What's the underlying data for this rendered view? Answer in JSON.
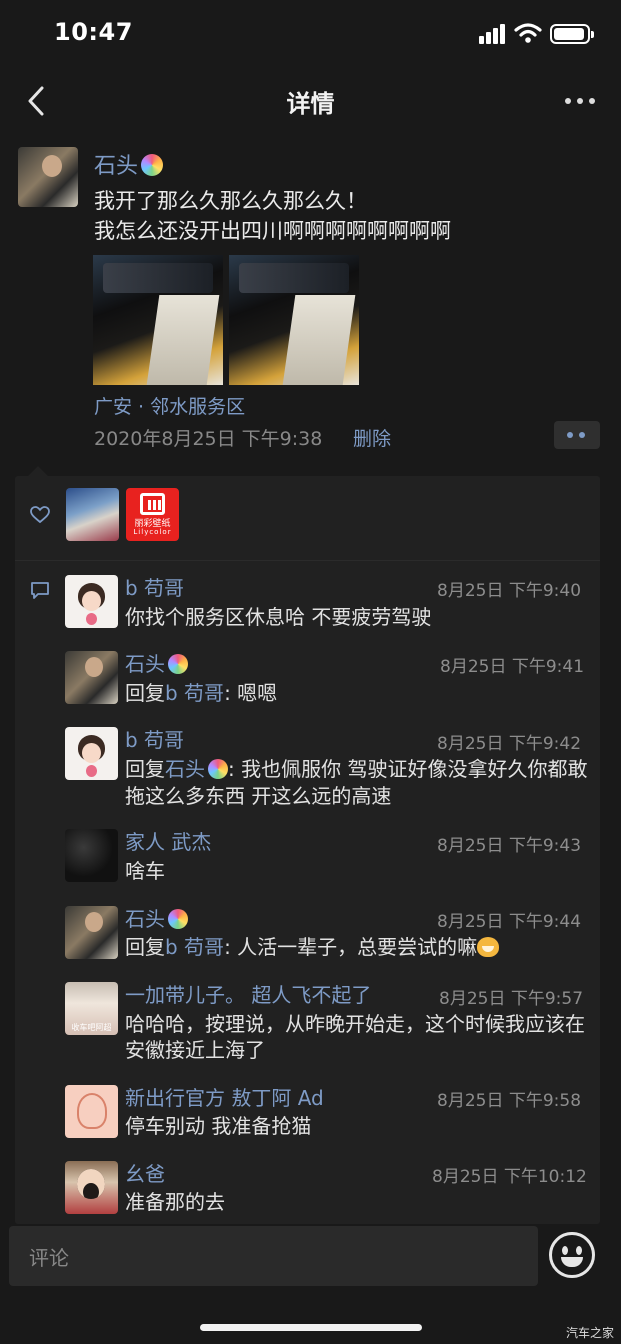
{
  "status_bar": {
    "time": "10:47"
  },
  "nav": {
    "title": "详情"
  },
  "post": {
    "author": "石头",
    "text_lines": [
      "我开了那么久那么久那么久！",
      "我怎么还没开出四川啊啊啊啊啊啊啊啊"
    ],
    "location": "广安 · 邻水服务区",
    "time": "2020年8月25日 下午9:38",
    "delete_label": "删除"
  },
  "likes": {
    "second_liker_logo": {
      "line1": "丽彩壁纸",
      "line2": "Lilycolor"
    }
  },
  "comments": [
    {
      "name": "b 苟哥",
      "time": "8月25日 下午9:40",
      "text": "你找个服务区休息哈 不要疲劳驾驶"
    },
    {
      "name": "石头",
      "time": "8月25日 下午9:41",
      "reply_prefix": "回复",
      "reply_to": "b 苟哥",
      "text": ": 嗯嗯"
    },
    {
      "name": "b 苟哥",
      "time": "8月25日 下午9:42",
      "reply_prefix": "回复",
      "reply_to": "石头",
      "text": ": 我也佩服你 驾驶证好像没拿好久你都敢拖这么多东西 开这么远的高速"
    },
    {
      "name": "家人 武杰",
      "time": "8月25日 下午9:43",
      "text": "啥车"
    },
    {
      "name": "石头",
      "time": "8月25日 下午9:44",
      "reply_prefix": "回复",
      "reply_to": "b 苟哥",
      "text": ": 人活一辈子，总要尝试的嘛"
    },
    {
      "name": "一加带儿子。 超人飞不起了",
      "time": "8月25日 下午9:57",
      "avatar_caption": "收车吧阿超",
      "text": "哈哈哈，按理说，从昨晚开始走，这个时候我应该在安徽接近上海了"
    },
    {
      "name": "新出行官方 敖丁阿 Ad",
      "time": "8月25日 下午9:58",
      "text": "停车别动 我准备抢猫"
    },
    {
      "name": "幺爸",
      "time": "8月25日 下午10:12",
      "text": "准备那的去"
    }
  ],
  "input": {
    "placeholder": "评论"
  },
  "watermark": "汽车之家",
  "colors": {
    "link": "#7e9bc6",
    "background": "#191919",
    "panel": "#212121"
  }
}
